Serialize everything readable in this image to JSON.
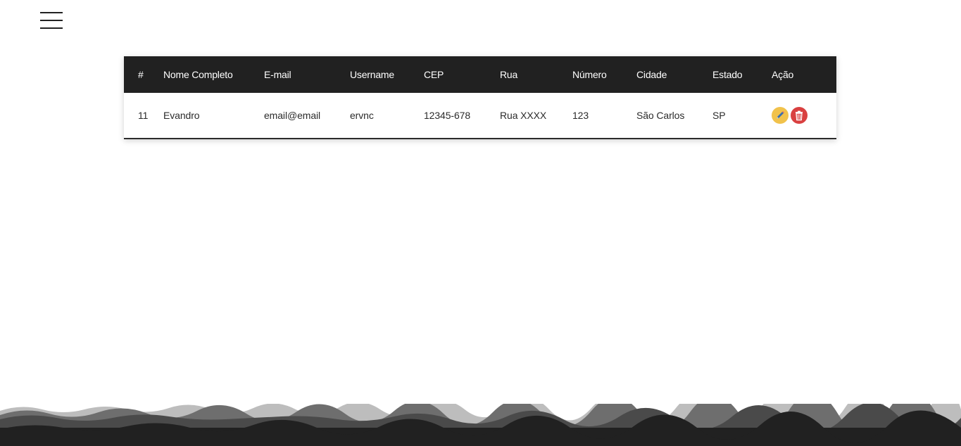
{
  "table": {
    "headers": [
      "#",
      "Nome Completo",
      "E-mail",
      "Username",
      "CEP",
      "Rua",
      "Número",
      "Cidade",
      "Estado",
      "Ação"
    ],
    "rows": [
      {
        "id": "11",
        "nome": "Evandro",
        "email": "email@email",
        "username": "ervnc",
        "cep": "12345-678",
        "rua": "Rua XXXX",
        "numero": "123",
        "cidade": "São Carlos",
        "estado": "SP",
        "actions": [
          {
            "icon": "pencil-icon",
            "color": "#f1c24b"
          },
          {
            "icon": "trash-icon",
            "color": "#d94040"
          }
        ]
      }
    ]
  },
  "colors": {
    "header_bg": "#212121",
    "footer_bg": "#212121"
  }
}
